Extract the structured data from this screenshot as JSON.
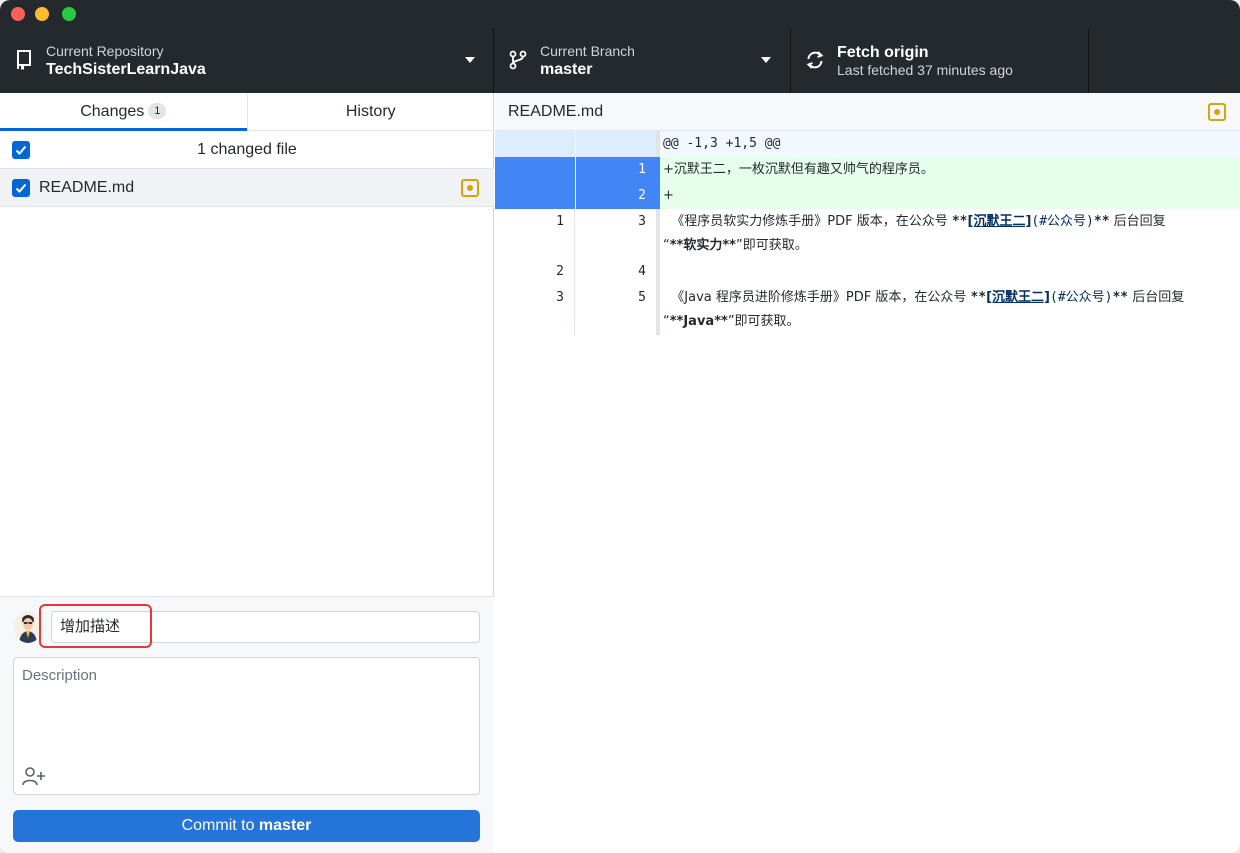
{
  "toolbar": {
    "repo_label": "Current Repository",
    "repo_name": "TechSisterLearnJava",
    "branch_label": "Current Branch",
    "branch_name": "master",
    "fetch_title": "Fetch origin",
    "fetch_status": "Last fetched 37 minutes ago"
  },
  "tabs": {
    "changes": "Changes",
    "changes_count": "1",
    "history": "History"
  },
  "changes": {
    "summary": "1 changed file",
    "files": [
      {
        "name": "README.md"
      }
    ]
  },
  "commit": {
    "summary_value": "增加描述",
    "description_placeholder": "Description",
    "button_prefix": "Commit to ",
    "button_branch": "master"
  },
  "diff": {
    "file_name": "README.md",
    "hunk": "@@ -1,3 +1,5 @@",
    "added": [
      {
        "new": "1",
        "text": "+沉默王二，一枚沉默但有趣又帅气的程序员。"
      },
      {
        "new": "2",
        "text": "+"
      }
    ],
    "context": [
      {
        "old": "1",
        "new": "3",
        "pre": "  《程序员软实力修炼手册》PDF 版本，在公众号 ",
        "stars1": "**",
        "link": "[沉默王二]",
        "anchor": "(#公众号)",
        "stars2": "**",
        "post1": " 后台回复",
        "post2": "“",
        "bold": "**软实力**",
        "end": "”即可获取。"
      },
      {
        "old": "2",
        "new": "4"
      },
      {
        "old": "3",
        "new": "5",
        "pre": "  《Java 程序员进阶修炼手册》PDF 版本，在公众号 ",
        "stars1": "**",
        "link": "[沉默王二]",
        "anchor": "(#公众号)",
        "stars2": "**",
        "post1": " 后台回复",
        "post2": "“",
        "bold": "**Java**",
        "end": "”即可获取。"
      }
    ]
  }
}
